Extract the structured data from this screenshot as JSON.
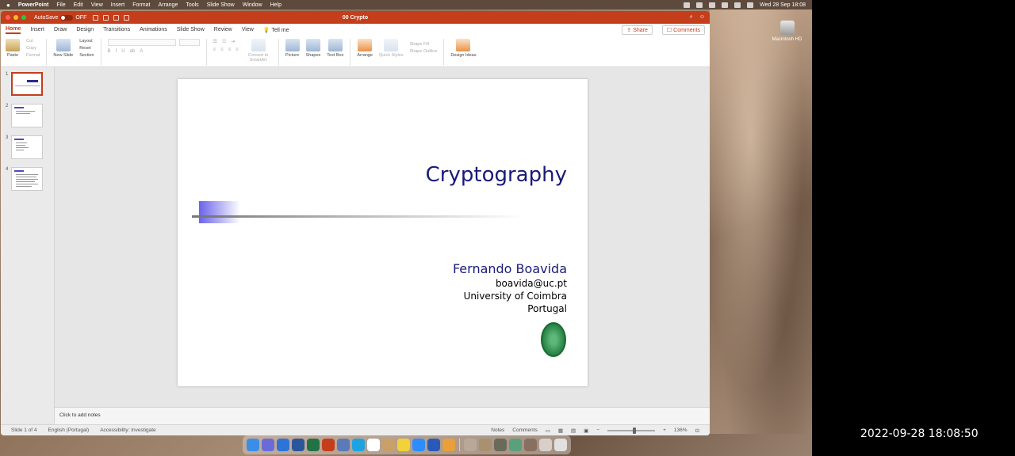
{
  "menubar": {
    "apple": "",
    "app": "PowerPoint",
    "items": [
      "File",
      "Edit",
      "View",
      "Insert",
      "Format",
      "Arrange",
      "Tools",
      "Slide Show",
      "Window",
      "Help"
    ],
    "datetime": "Wed 28 Sep 18:08"
  },
  "desktop": {
    "drive_label": "Macintosh HD"
  },
  "window": {
    "autosave_label": "AutoSave",
    "autosave_state": "OFF",
    "title": "00 Crypto"
  },
  "tabs": [
    "Home",
    "Insert",
    "Draw",
    "Design",
    "Transitions",
    "Animations",
    "Slide Show",
    "Review",
    "View"
  ],
  "tell_me": "Tell me",
  "share": "Share",
  "comments": "Comments",
  "ribbon": {
    "paste": "Paste",
    "cut": "Cut",
    "copy": "Copy",
    "format": "Format",
    "new_slide": "New Slide",
    "layout": "Layout",
    "reset": "Reset",
    "section": "Section",
    "convert": "Convert to SmartArt",
    "picture": "Picture",
    "shapes": "Shapes",
    "text_box": "Text Box",
    "arrange": "Arrange",
    "quick_styles": "Quick Styles",
    "shape_fill": "Shape Fill",
    "shape_outline": "Shape Outline",
    "design_ideas": "Design Ideas"
  },
  "thumbnails": [
    "1",
    "2",
    "3",
    "4"
  ],
  "slide": {
    "title": "Cryptography",
    "author": "Fernando Boavida",
    "email": "boavida@uc.pt",
    "university": "University of Coimbra",
    "country": "Portugal"
  },
  "notes_placeholder": "Click to add notes",
  "status": {
    "slide_count": "Slide 1 of 4",
    "language": "English (Portugal)",
    "accessibility": "Accessibility: Investigate",
    "notes": "Notes",
    "comments": "Comments",
    "zoom": "136%"
  },
  "recording_timestamp": "2022-09-28 18:08:50",
  "colors": {
    "accent": "#c43e1c",
    "slide_title": "#1a1a7a"
  }
}
